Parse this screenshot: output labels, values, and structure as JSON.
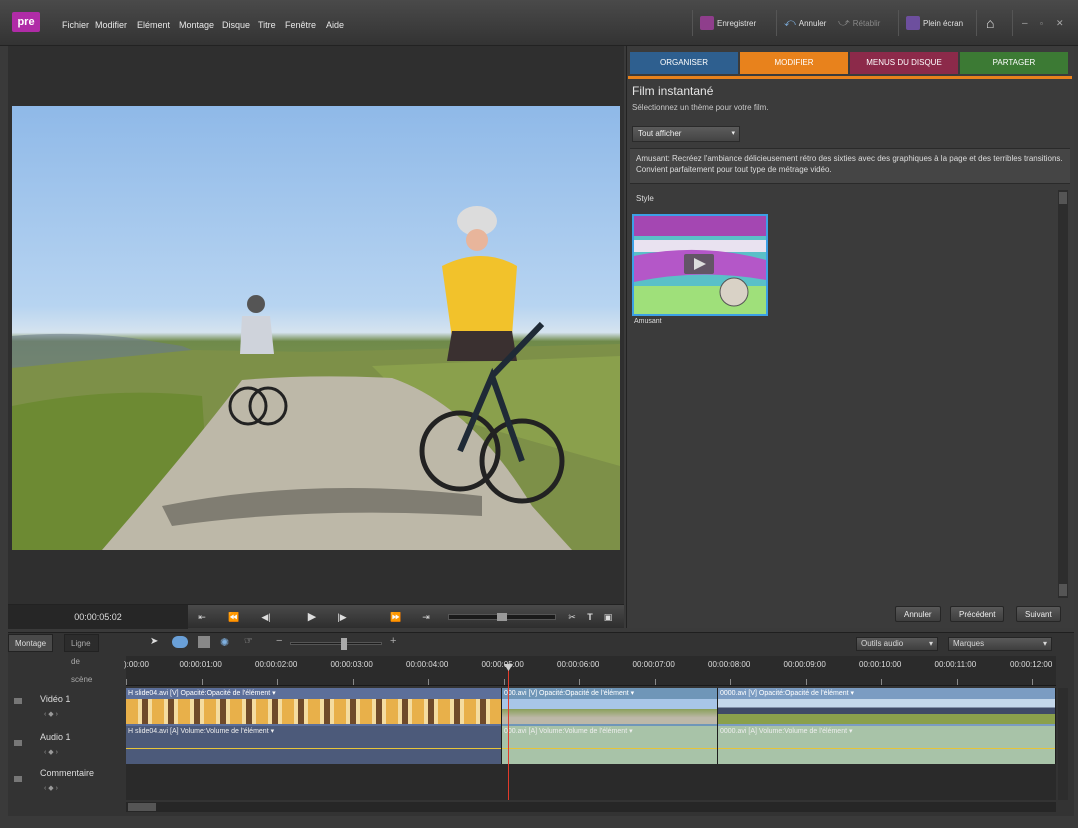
{
  "app": {
    "logo": "pre"
  },
  "menu": [
    "Fichier",
    "Modifier",
    "Elément",
    "Montage",
    "Disque",
    "Titre",
    "Fenêtre",
    "Aide"
  ],
  "toolbar": {
    "save": "Enregistrer",
    "undo": "Annuler",
    "redo": "Rétablir",
    "fullscreen": "Plein écran"
  },
  "monitor": {
    "timecode": "00:00:05:02"
  },
  "tabs": [
    {
      "label": "ORGANISER",
      "color": "#2e5f8f"
    },
    {
      "label": "MODIFIER",
      "color": "#e8821c"
    },
    {
      "label": "MENUS DU DISQUE",
      "color": "#8c2a4a"
    },
    {
      "label": "PARTAGER",
      "color": "#3c7a34"
    }
  ],
  "panel": {
    "title": "Film instantané",
    "subtitle": "Sélectionnez un thème pour votre film.",
    "filter": "Tout afficher",
    "description": "Amusant: Recréez l'ambiance délicieusement rétro des sixties avec des graphiques à la page et des terribles transitions. Convient parfaitement pour tout type de métrage vidéo.",
    "style_label": "Style",
    "theme_name": "Amusant",
    "buttons": {
      "cancel": "Annuler",
      "previous": "Précédent",
      "next": "Suivant"
    }
  },
  "timeline": {
    "tabs": [
      "Montage",
      "Ligne de scène"
    ],
    "audio_tools": "Outils audio",
    "markers": "Marques",
    "ticks": [
      "):00:00",
      "00:00:01:00",
      "00:00:02:00",
      "00:00:03:00",
      "00:00:04:00",
      "00:00:05:00",
      "00:00:06:00",
      "00:00:07:00",
      "00:00:08:00",
      "00:00:09:00",
      "00:00:10:00",
      "00:00:11:00",
      "00:00:12:00"
    ],
    "tracks": {
      "video": "Vidéo 1",
      "audio": "Audio 1",
      "comment": "Commentaire"
    },
    "clips": {
      "v1": "H slide04.avi [V] Opacité:Opacité de l'élément ▾",
      "v2": "000.avi [V] Opacité:Opacité de l'élément ▾",
      "v3": "0000.avi [V] Opacité:Opacité de l'élément ▾",
      "a1": "H slide04.avi [A] Volume:Volume de l'élément ▾",
      "a2": "000.avi [A] Volume:Volume de l'élément ▾",
      "a3": "0000.avi [A] Volume:Volume de l'élément ▾"
    }
  }
}
